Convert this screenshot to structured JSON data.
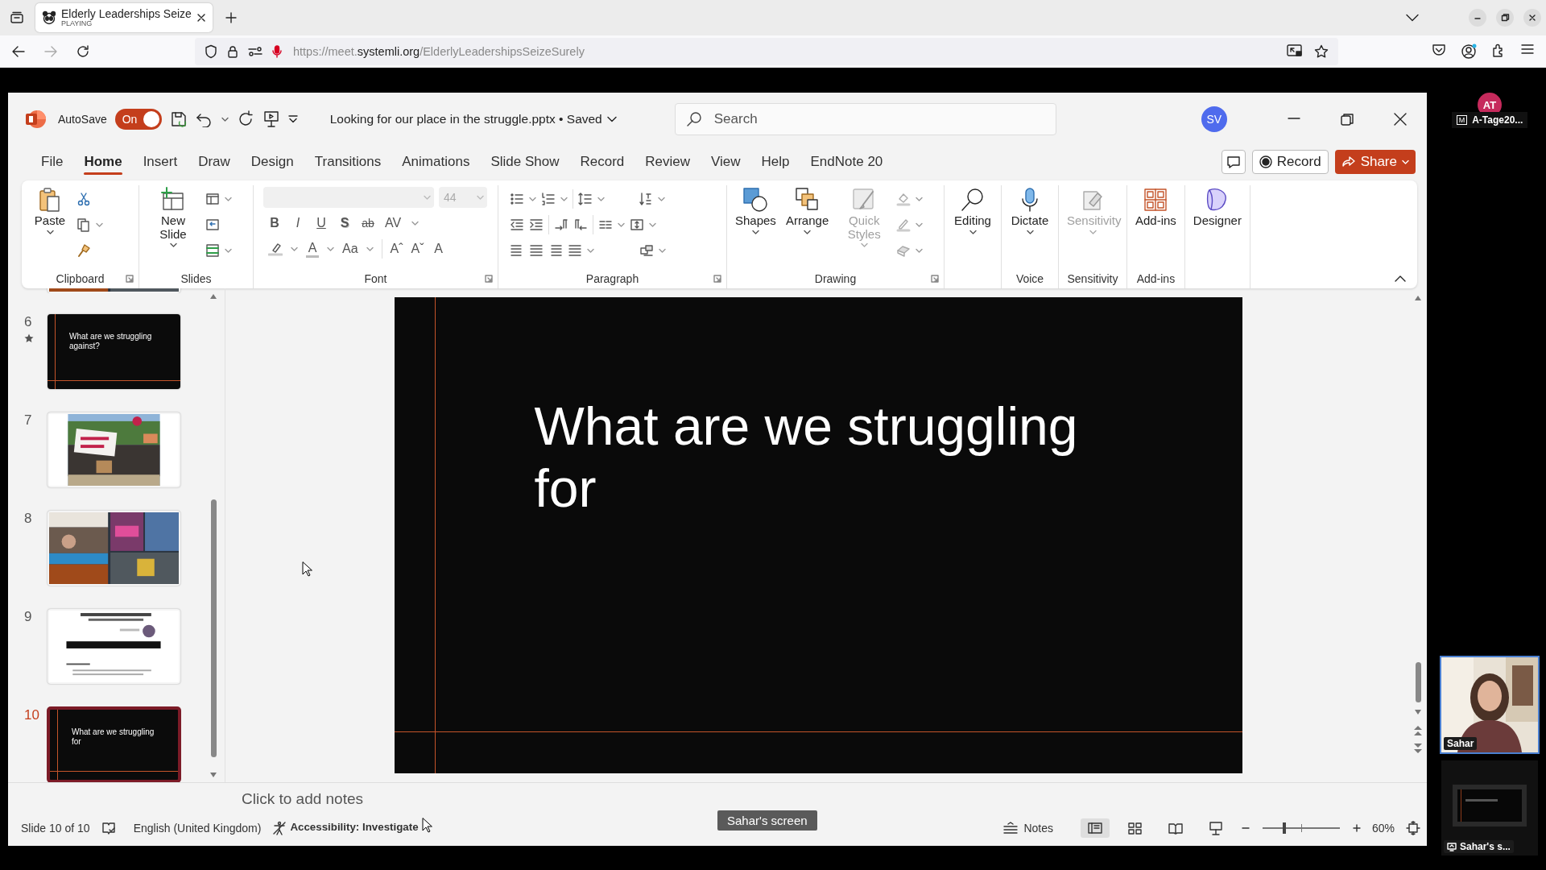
{
  "browser": {
    "tab": {
      "title": "Elderly Leaderships Seize",
      "status": "PLAYING"
    },
    "address": {
      "scheme": "https://meet.",
      "domain": "systemli.org",
      "path": "/ElderlyLeadershipsSeizeSurely"
    }
  },
  "powerpoint": {
    "autosave": {
      "label": "AutoSave",
      "on": true,
      "state_text": "On"
    },
    "document": {
      "name": "Looking for our place in the struggle.pptx",
      "separator": "•",
      "status": "Saved"
    },
    "search": {
      "placeholder": "Search"
    },
    "account": {
      "initials": "SV"
    },
    "tabs": [
      {
        "label": "File",
        "selected": false
      },
      {
        "label": "Home",
        "selected": true
      },
      {
        "label": "Insert",
        "selected": false
      },
      {
        "label": "Draw",
        "selected": false
      },
      {
        "label": "Design",
        "selected": false
      },
      {
        "label": "Transitions",
        "selected": false
      },
      {
        "label": "Animations",
        "selected": false
      },
      {
        "label": "Slide Show",
        "selected": false
      },
      {
        "label": "Record",
        "selected": false
      },
      {
        "label": "Review",
        "selected": false
      },
      {
        "label": "View",
        "selected": false
      },
      {
        "label": "Help",
        "selected": false
      },
      {
        "label": "EndNote 20",
        "selected": false
      }
    ],
    "record_button": "Record",
    "share_button": "Share",
    "ribbon": {
      "groups": [
        {
          "kind": "clipboard",
          "label": "Clipboard",
          "commands": [
            {
              "label": "Paste"
            }
          ]
        },
        {
          "kind": "slides",
          "label": "Slides",
          "commands": [
            {
              "label": "New Slide"
            }
          ]
        },
        {
          "kind": "font",
          "label": "Font",
          "size": "44",
          "styles": [
            "B",
            "I",
            "U",
            "S",
            "ab",
            "AV"
          ],
          "tools": [
            "A",
            "Aa",
            "Aˆ",
            "Aˇ",
            "A"
          ]
        },
        {
          "kind": "paragraph",
          "label": "Paragraph"
        },
        {
          "kind": "drawing",
          "label": "Drawing",
          "commands": [
            {
              "label": "Shapes",
              "disabled": false,
              "menu": true
            },
            {
              "label": "Arrange",
              "disabled": false,
              "menu": true
            },
            {
              "label": "Quick Styles",
              "disabled": true,
              "menu": true
            }
          ]
        },
        {
          "kind": "large",
          "commands": [
            {
              "label": "Editing",
              "disabled": false,
              "menu": true
            }
          ]
        },
        {
          "kind": "large",
          "label": "Voice",
          "commands": [
            {
              "label": "Dictate",
              "disabled": false,
              "menu": true
            }
          ]
        },
        {
          "kind": "large",
          "label": "Sensitivity",
          "commands": [
            {
              "label": "Sensitivity",
              "disabled": true,
              "menu": true
            }
          ]
        },
        {
          "kind": "large",
          "label": "Add-ins",
          "commands": [
            {
              "label": "Add-ins",
              "disabled": false,
              "menu": false
            }
          ]
        },
        {
          "kind": "large",
          "commands": [
            {
              "label": "Designer",
              "disabled": false,
              "menu": false
            }
          ]
        }
      ]
    },
    "thumbnails": [
      {
        "kind": "picture",
        "cut_off": true,
        "selected": false,
        "animated": false
      },
      {
        "kind": "text",
        "number": "6",
        "title": "What are we struggling against?",
        "cut_off": false,
        "selected": false,
        "animated": true
      },
      {
        "kind": "picture",
        "number": "7",
        "cut_off": false,
        "selected": false,
        "animated": false
      },
      {
        "kind": "picture",
        "number": "8",
        "cut_off": false,
        "selected": false,
        "animated": false
      },
      {
        "kind": "picture",
        "number": "9",
        "cut_off": false,
        "selected": false,
        "animated": false
      },
      {
        "kind": "text",
        "number": "10",
        "title": "What are we struggling for",
        "cut_off": false,
        "selected": true,
        "animated": false
      }
    ],
    "slide": {
      "title": "What are we struggling for"
    },
    "notes": {
      "placeholder": "Click to add notes"
    },
    "status_bar": {
      "slide_position": "Slide 10 of 10",
      "language": "English (United Kingdom)",
      "accessibility": "Accessibility: Investigate",
      "notes_button": "Notes",
      "views": [
        {
          "selected": true
        },
        {
          "selected": false
        },
        {
          "selected": false
        },
        {
          "selected": false
        }
      ],
      "zoom": {
        "level": 0.27,
        "reading": "60%"
      }
    }
  },
  "participants": [
    {
      "initials": "AT",
      "color": "#c62a5c",
      "badge": "M",
      "name": "A-Tage20..."
    }
  ],
  "video_tiles": [
    {
      "kind": "camera",
      "name": "Sahar",
      "speaking": true
    },
    {
      "kind": "screen",
      "name": "Sahar's s...",
      "speaking": false
    }
  ],
  "tooltip": "Sahar's screen"
}
